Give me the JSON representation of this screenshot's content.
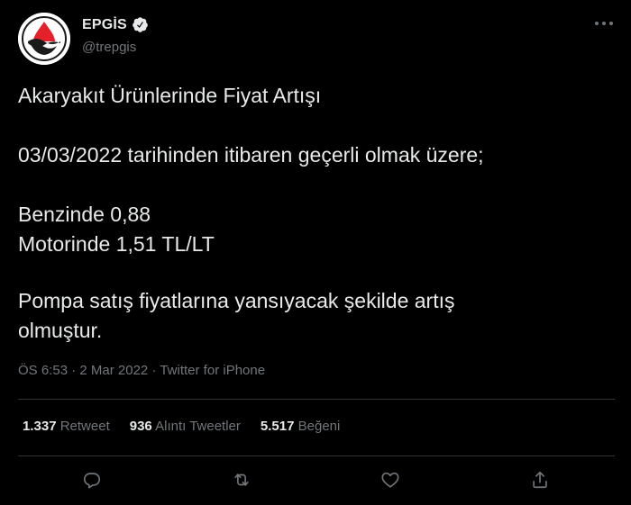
{
  "user": {
    "display_name": "EPGİS",
    "handle": "@trepgis",
    "avatar_icon": "epgis-logo-icon",
    "verified_icon": "verified-badge-icon"
  },
  "more_icon": "more-icon",
  "tweet": {
    "line1": "Akaryakıt Ürünlerinde Fiyat Artışı",
    "line2": "03/03/2022 tarihinden itibaren geçerli olmak üzere;",
    "line3": "Benzinde 0,88",
    "line4": "Motorinde 1,51 TL/LT",
    "line5": "Pompa satış fiyatlarına yansıyacak şekilde artış",
    "line6": "olmuştur."
  },
  "meta": {
    "time": "ÖS 6:53",
    "sep1": " · ",
    "date": "2 Mar 2022",
    "sep2": " · ",
    "source": "Twitter for iPhone"
  },
  "stats": {
    "retweets_count": "1.337",
    "retweets_label": "Retweet",
    "quotes_count": "936",
    "quotes_label": "Alıntı Tweetler",
    "likes_count": "5.517",
    "likes_label": "Beğeni"
  },
  "actions": {
    "reply_icon": "reply-icon",
    "retweet_icon": "retweet-icon",
    "like_icon": "heart-icon",
    "share_icon": "share-icon"
  },
  "colors": {
    "background": "#000000",
    "text": "#e7e9ea",
    "secondary": "#71767b",
    "divider": "#2f3336",
    "logo_red": "#e4202a"
  }
}
